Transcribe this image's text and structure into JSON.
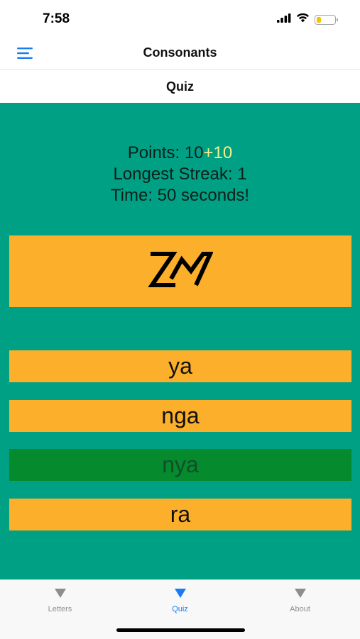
{
  "status_bar": {
    "time": "7:58",
    "icons": [
      "signal-icon",
      "wifi-icon",
      "battery-icon"
    ],
    "battery_level": 0.25
  },
  "nav": {
    "title": "Consonants",
    "menu_icon": "hamburger-menu-icon"
  },
  "sub_nav": {
    "title": "Quiz"
  },
  "quiz": {
    "points_label": "Points: ",
    "points_value": "10",
    "points_gain": "+10",
    "streak_text": "Longest Streak: 1",
    "time_text": "Time: 50 seconds!",
    "question_glyph": "baybayin-nya-glyph",
    "answers": [
      {
        "label": "ya",
        "state": "default"
      },
      {
        "label": "nga",
        "state": "default"
      },
      {
        "label": "nya",
        "state": "correct"
      },
      {
        "label": "ra",
        "state": "default"
      }
    ]
  },
  "tabs": [
    {
      "label": "Letters",
      "icon": "triangle-down-icon",
      "active": false
    },
    {
      "label": "Quiz",
      "icon": "triangle-down-icon",
      "active": true
    },
    {
      "label": "About",
      "icon": "triangle-down-icon",
      "active": false
    }
  ],
  "colors": {
    "quiz_background": "#00a085",
    "card_orange": "#fcaf2a",
    "correct_green": "#058a2e",
    "points_gain": "#f5f08a",
    "tab_active": "#1a7cf0",
    "tab_inactive": "#8e8e8e",
    "menu_blue": "#1a7cf0"
  }
}
